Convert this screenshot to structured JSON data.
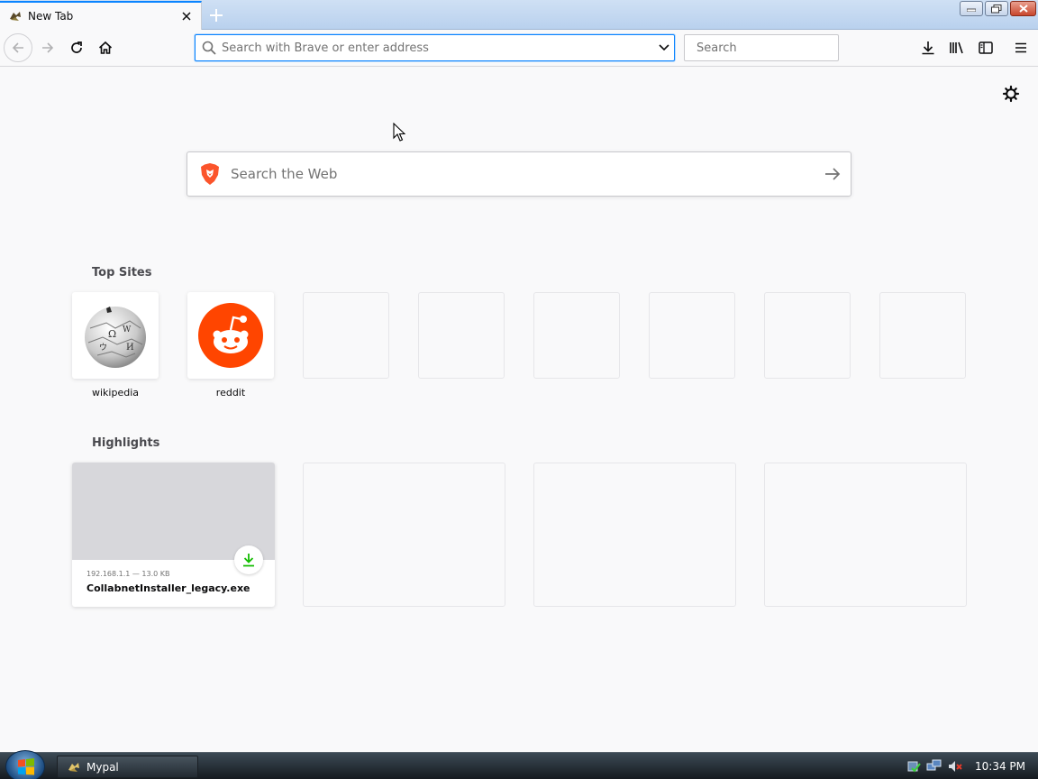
{
  "tab": {
    "title": "New Tab"
  },
  "navbar": {
    "url_placeholder": "Search with Brave or enter address",
    "search_placeholder": "Search"
  },
  "newtab": {
    "web_search_placeholder": "Search the Web",
    "top_sites_title": "Top Sites",
    "top_sites": [
      {
        "label": "wikipedia",
        "icon": "wikipedia-globe-icon"
      },
      {
        "label": "reddit",
        "icon": "reddit-icon"
      }
    ],
    "highlights_title": "Highlights",
    "highlights": [
      {
        "meta": "192.168.1.1 — 13.0 KB",
        "title": "CollabnetInstaller_legacy.exe",
        "icon": "download-icon"
      }
    ]
  },
  "taskbar": {
    "app_label": "Mypal",
    "clock": "10:34 PM"
  },
  "colors": {
    "accent": "#0a84ff",
    "reddit": "#ff4500",
    "download_green": "#12bc00"
  }
}
